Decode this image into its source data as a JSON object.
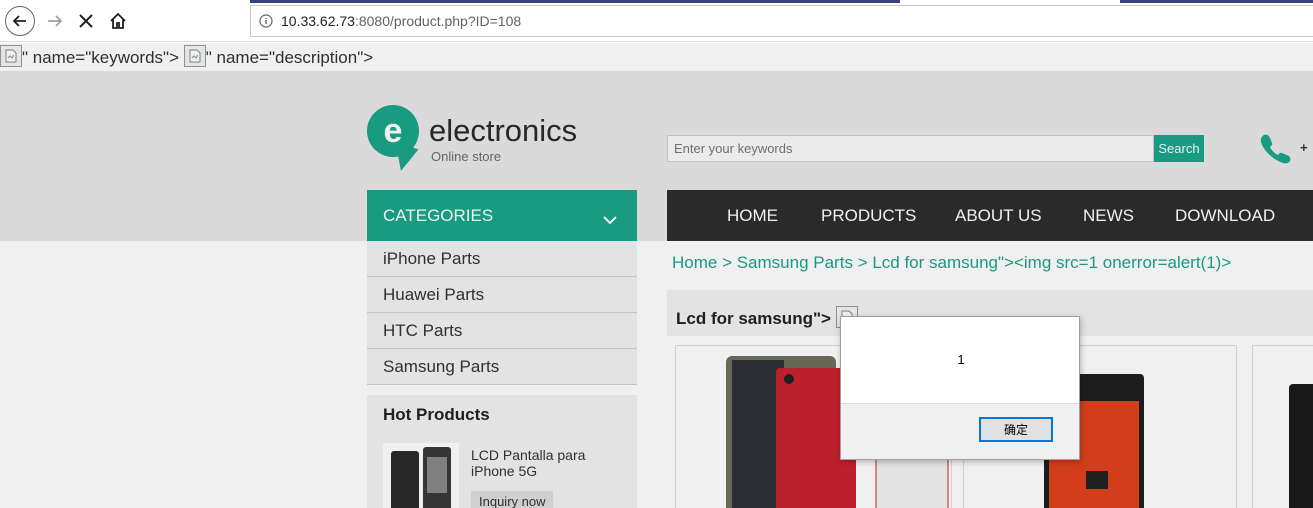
{
  "browser": {
    "url_host": "10.33.62.73",
    "url_rest": ":8080/product.php?ID=108"
  },
  "leak": {
    "keywords_text": "\" name=\"keywords\">",
    "description_text": "\" name=\"description\">"
  },
  "logo": {
    "letter": "e",
    "name": "electronics",
    "tagline": "Online store"
  },
  "search": {
    "placeholder": "Enter your keywords",
    "button_label": "Search"
  },
  "phone": {
    "text": "+"
  },
  "categories": {
    "title": "CATEGORIES",
    "items": [
      "iPhone Parts",
      "Huawei Parts",
      "HTC Parts",
      "Samsung Parts"
    ]
  },
  "nav": {
    "items": [
      "HOME",
      "PRODUCTS",
      "ABOUT US",
      "NEWS",
      "DOWNLOAD"
    ]
  },
  "breadcrumb": {
    "text": "Home > Samsung Parts > Lcd for samsung\"><img src=1 onerror=alert(1)>"
  },
  "product_heading": {
    "text": "Lcd for samsung\">"
  },
  "hot_products": {
    "title": "Hot Products",
    "item_name": "LCD Pantalla para iPhone 5G",
    "inquiry_label": "Inquiry now"
  },
  "dialog": {
    "message": "1",
    "ok_label": "确定"
  },
  "colors": {
    "accent": "#1aa58a",
    "nav_bg": "#2d2d2d"
  }
}
